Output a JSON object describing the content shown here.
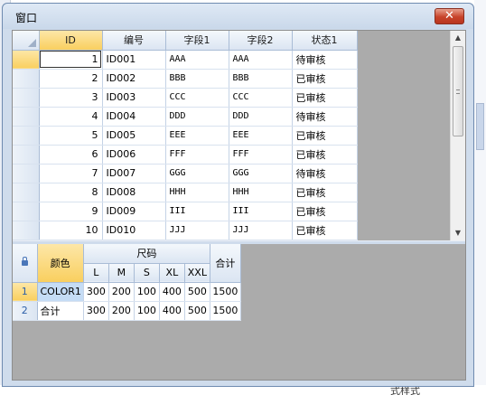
{
  "window": {
    "title": "窗口",
    "close_glyph": "✕"
  },
  "grid1": {
    "columns": [
      "ID",
      "编号",
      "字段1",
      "字段2",
      "状态1"
    ],
    "rows": [
      {
        "id": "1",
        "code": "ID001",
        "f1": "AAA",
        "f2": "AAA",
        "status": "待审核"
      },
      {
        "id": "2",
        "code": "ID002",
        "f1": "BBB",
        "f2": "BBB",
        "status": "已审核"
      },
      {
        "id": "3",
        "code": "ID003",
        "f1": "CCC",
        "f2": "CCC",
        "status": "已审核"
      },
      {
        "id": "4",
        "code": "ID004",
        "f1": "DDD",
        "f2": "DDD",
        "status": "待审核"
      },
      {
        "id": "5",
        "code": "ID005",
        "f1": "EEE",
        "f2": "EEE",
        "status": "已审核"
      },
      {
        "id": "6",
        "code": "ID006",
        "f1": "FFF",
        "f2": "FFF",
        "status": "已审核"
      },
      {
        "id": "7",
        "code": "ID007",
        "f1": "GGG",
        "f2": "GGG",
        "status": "待审核"
      },
      {
        "id": "8",
        "code": "ID008",
        "f1": "HHH",
        "f2": "HHH",
        "status": "已审核"
      },
      {
        "id": "9",
        "code": "ID009",
        "f1": "III",
        "f2": "III",
        "status": "已审核"
      },
      {
        "id": "10",
        "code": "ID010",
        "f1": "JJJ",
        "f2": "JJJ",
        "status": "已审核"
      }
    ]
  },
  "grid2": {
    "color_header": "颜色",
    "size_header": "尺码",
    "sizes": [
      "L",
      "M",
      "S",
      "XL",
      "XXL"
    ],
    "total_header": "合计",
    "rows": [
      {
        "num": "1",
        "name": "COLOR1",
        "values": [
          "300",
          "200",
          "100",
          "400",
          "500"
        ],
        "total": "1500"
      },
      {
        "num": "2",
        "name": "合计",
        "values": [
          "300",
          "200",
          "100",
          "400",
          "500"
        ],
        "total": "1500"
      }
    ]
  },
  "background": {
    "bottom_right_text": "式样式"
  }
}
